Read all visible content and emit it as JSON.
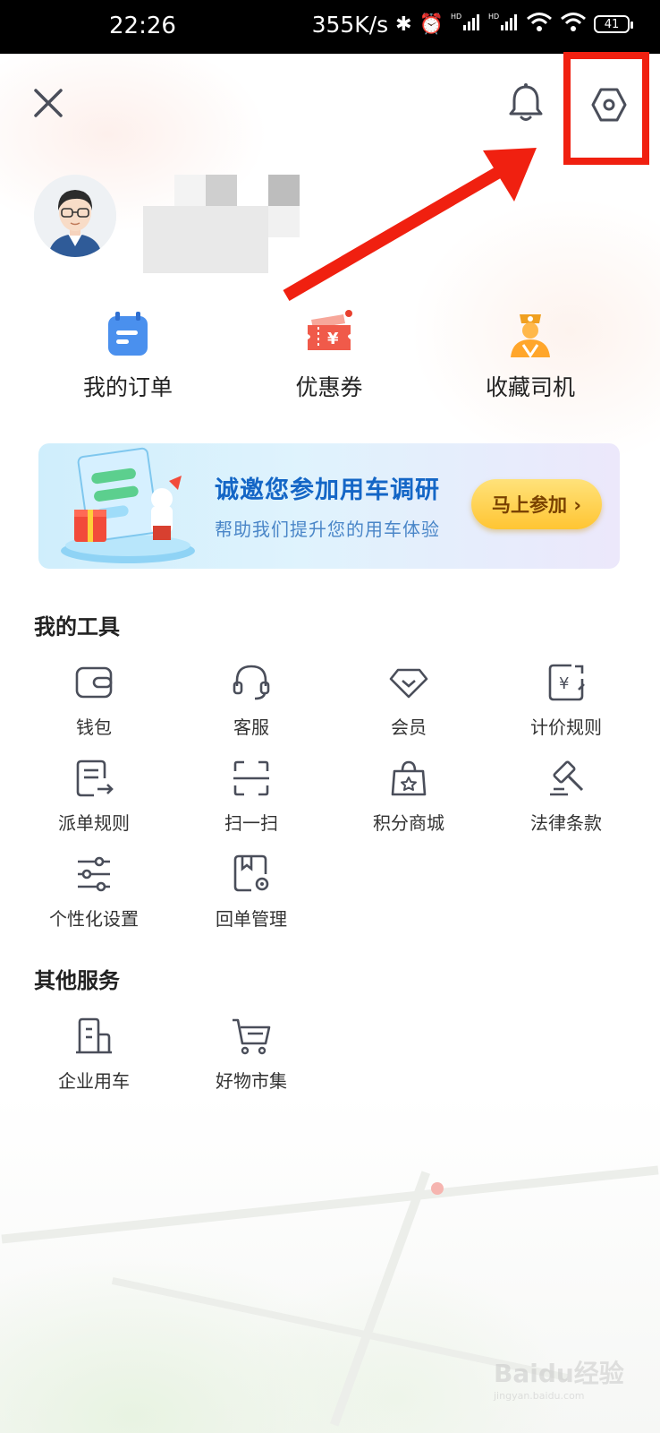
{
  "status_bar": {
    "time": "22:26",
    "network_speed": "355K/s",
    "battery": "41",
    "icons": [
      "bluetooth-icon",
      "alarm-icon",
      "signal-hd-icon",
      "signal-hd-icon",
      "wifi-icon",
      "wifi-icon",
      "battery-icon"
    ]
  },
  "header": {
    "close_icon": "close-icon",
    "bell_icon": "bell-icon",
    "settings_icon": "settings-hexagon-icon"
  },
  "quick_actions": [
    {
      "label": "我的订单",
      "icon": "orders-icon"
    },
    {
      "label": "优惠券",
      "icon": "coupon-icon"
    },
    {
      "label": "收藏司机",
      "icon": "favorite-driver-icon"
    }
  ],
  "banner": {
    "title": "诚邀您参加用车调研",
    "subtitle": "帮助我们提升您的用车体验",
    "button": "马上参加 ›"
  },
  "tools": {
    "title": "我的工具",
    "items": [
      {
        "label": "钱包",
        "icon": "wallet-icon"
      },
      {
        "label": "客服",
        "icon": "headset-icon"
      },
      {
        "label": "会员",
        "icon": "diamond-icon"
      },
      {
        "label": "计价规则",
        "icon": "price-rule-icon"
      },
      {
        "label": "派单规则",
        "icon": "dispatch-rule-icon"
      },
      {
        "label": "扫一扫",
        "icon": "scan-icon"
      },
      {
        "label": "积分商城",
        "icon": "points-mall-icon"
      },
      {
        "label": "法律条款",
        "icon": "gavel-icon"
      },
      {
        "label": "个性化设置",
        "icon": "sliders-icon"
      },
      {
        "label": "回单管理",
        "icon": "receipt-manage-icon"
      }
    ]
  },
  "other_services": {
    "title": "其他服务",
    "items": [
      {
        "label": "企业用车",
        "icon": "building-icon"
      },
      {
        "label": "好物市集",
        "icon": "cart-icon"
      }
    ]
  },
  "colors": {
    "accent_blue": "#1466c6",
    "highlight_red": "#f02010",
    "icon_gray": "#4a4e5a",
    "button_yellow": "#ffc533"
  },
  "watermark": {
    "brand": "Baidu经验",
    "url": "jingyan.baidu.com"
  }
}
